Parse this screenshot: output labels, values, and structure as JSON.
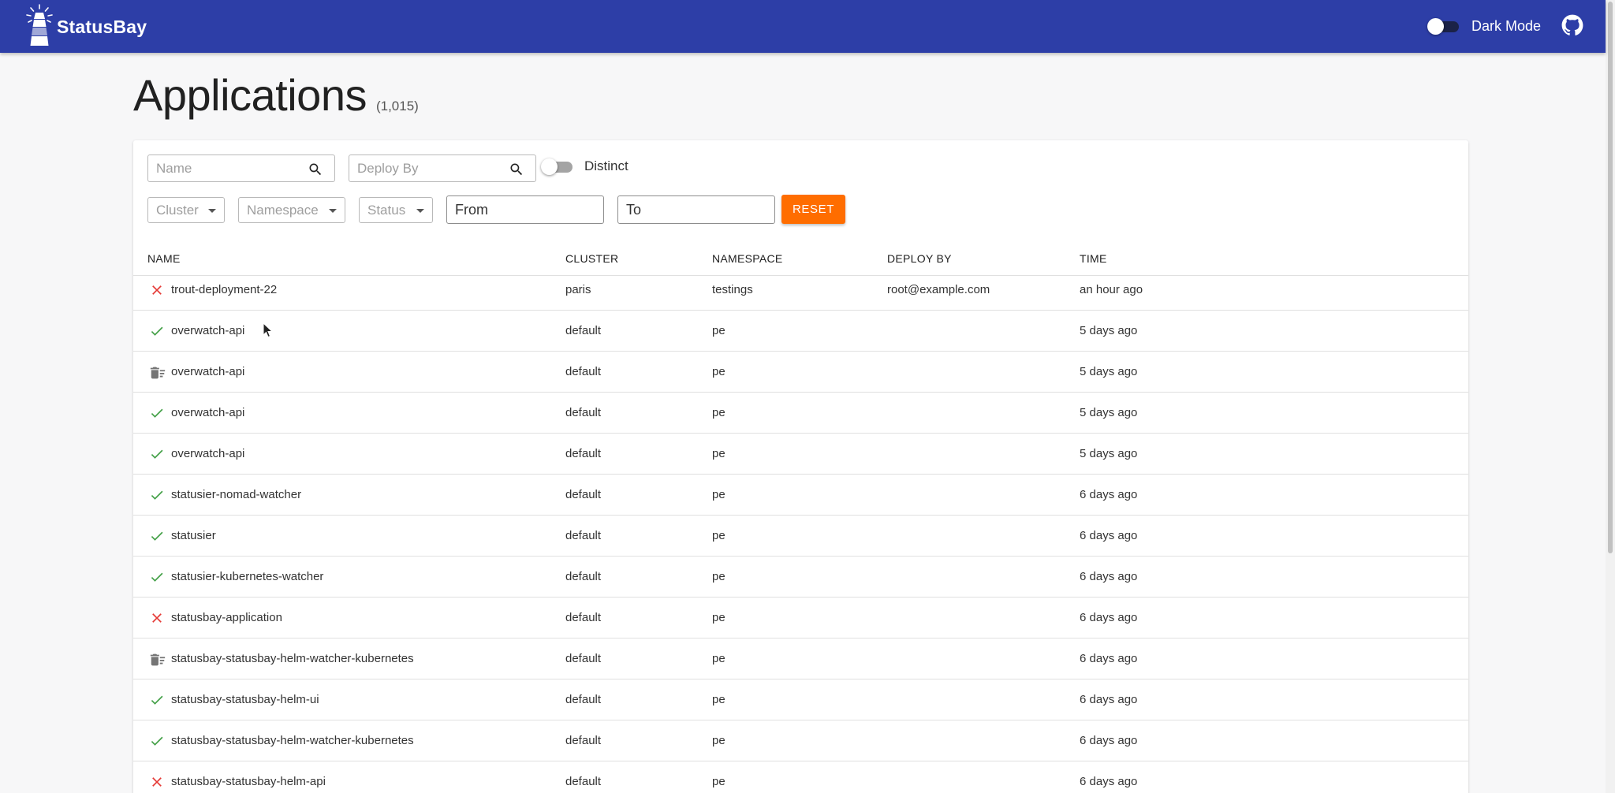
{
  "appbar": {
    "brand": "StatusBay",
    "dark_mode_label": "Dark Mode",
    "bg_color": "#2d3ea7"
  },
  "page": {
    "title": "Applications",
    "count": "(1,015)"
  },
  "filters": {
    "name_placeholder": "Name",
    "deploy_by_placeholder": "Deploy By",
    "distinct_label": "Distinct",
    "cluster_label": "Cluster",
    "namespace_label": "Namespace",
    "status_label": "Status",
    "from_label": "From",
    "to_label": "To",
    "reset_label": "RESET",
    "reset_color": "#ff6d00"
  },
  "table": {
    "columns": [
      "NAME",
      "CLUSTER",
      "NAMESPACE",
      "DEPLOY BY",
      "TIME"
    ],
    "rows": [
      {
        "status": "failed",
        "name": "trout-deployment-22",
        "cluster": "paris",
        "namespace": "testings",
        "deploy_by": "root@example.com",
        "time": "an hour ago"
      },
      {
        "status": "success",
        "name": "overwatch-api",
        "cluster": "default",
        "namespace": "pe",
        "deploy_by": "",
        "time": "5 days ago"
      },
      {
        "status": "deleted",
        "name": "overwatch-api",
        "cluster": "default",
        "namespace": "pe",
        "deploy_by": "",
        "time": "5 days ago"
      },
      {
        "status": "success",
        "name": "overwatch-api",
        "cluster": "default",
        "namespace": "pe",
        "deploy_by": "",
        "time": "5 days ago"
      },
      {
        "status": "success",
        "name": "overwatch-api",
        "cluster": "default",
        "namespace": "pe",
        "deploy_by": "",
        "time": "5 days ago"
      },
      {
        "status": "success",
        "name": "statusier-nomad-watcher",
        "cluster": "default",
        "namespace": "pe",
        "deploy_by": "",
        "time": "6 days ago"
      },
      {
        "status": "success",
        "name": "statusier",
        "cluster": "default",
        "namespace": "pe",
        "deploy_by": "",
        "time": "6 days ago"
      },
      {
        "status": "success",
        "name": "statusier-kubernetes-watcher",
        "cluster": "default",
        "namespace": "pe",
        "deploy_by": "",
        "time": "6 days ago"
      },
      {
        "status": "failed",
        "name": "statusbay-application",
        "cluster": "default",
        "namespace": "pe",
        "deploy_by": "",
        "time": "6 days ago"
      },
      {
        "status": "deleted",
        "name": "statusbay-statusbay-helm-watcher-kubernetes",
        "cluster": "default",
        "namespace": "pe",
        "deploy_by": "",
        "time": "6 days ago"
      },
      {
        "status": "success",
        "name": "statusbay-statusbay-helm-ui",
        "cluster": "default",
        "namespace": "pe",
        "deploy_by": "",
        "time": "6 days ago"
      },
      {
        "status": "success",
        "name": "statusbay-statusbay-helm-watcher-kubernetes",
        "cluster": "default",
        "namespace": "pe",
        "deploy_by": "",
        "time": "6 days ago"
      },
      {
        "status": "failed",
        "name": "statusbay-statusbay-helm-api",
        "cluster": "default",
        "namespace": "pe",
        "deploy_by": "",
        "time": "6 days ago"
      }
    ]
  },
  "icons": {
    "success": "check-icon",
    "failed": "close-icon",
    "deleted": "delete-sweep-icon"
  },
  "colors": {
    "success": "#43a047",
    "failed": "#e53935",
    "deleted": "#757575"
  }
}
